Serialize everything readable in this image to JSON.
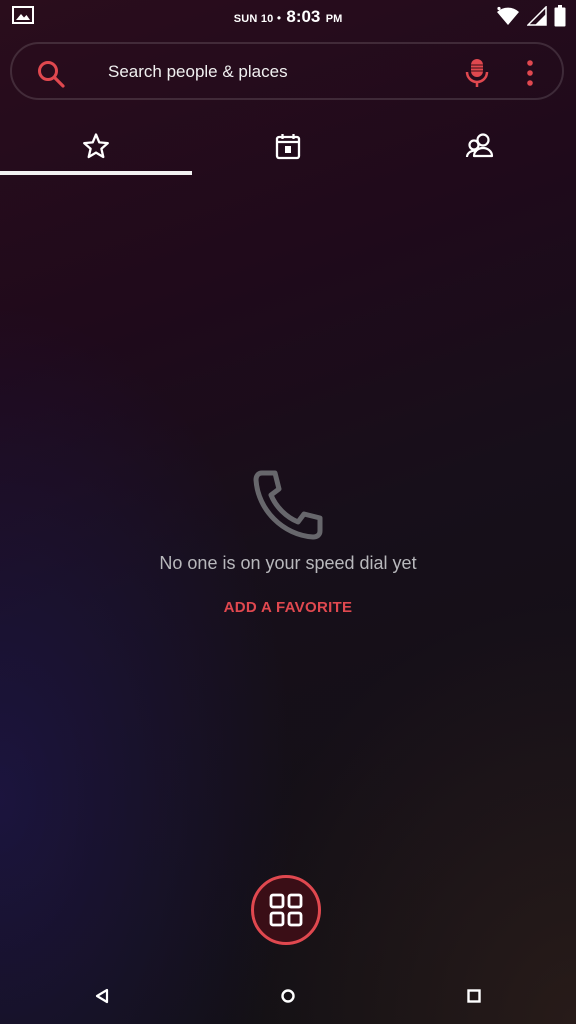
{
  "status_bar": {
    "date": "SUN 10",
    "separator": "•",
    "time": "8:03",
    "ampm": "PM",
    "icons": [
      "image-notification-icon",
      "wifi-icon",
      "signal-icon",
      "battery-icon"
    ]
  },
  "search": {
    "placeholder": "Search people & places",
    "value": "",
    "icons": [
      "search-icon",
      "mic-icon",
      "more-vert-icon"
    ]
  },
  "tabs": [
    {
      "name": "favorites",
      "icon": "star-icon",
      "selected": true
    },
    {
      "name": "recents",
      "icon": "calendar-icon",
      "selected": false
    },
    {
      "name": "contacts",
      "icon": "people-icon",
      "selected": false
    }
  ],
  "empty_state": {
    "icon": "phone-icon",
    "message": "No one is on your speed dial yet",
    "action": "ADD A FAVORITE"
  },
  "fab": {
    "icon": "dialpad-grid-icon"
  },
  "nav_bar": {
    "icons": [
      "back-icon",
      "home-icon",
      "recents-icon"
    ]
  },
  "colors": {
    "accent": "#e0484f",
    "text_primary": "#ffffff",
    "text_secondary": "#b8b8bc",
    "indicator": "#f2f2f2"
  }
}
